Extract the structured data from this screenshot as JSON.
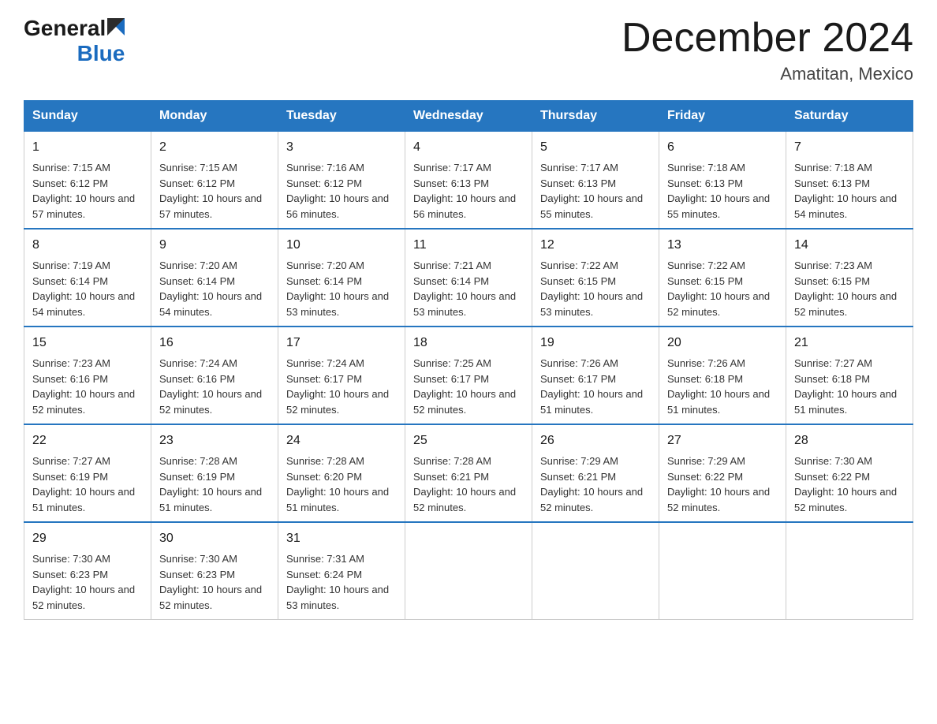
{
  "header": {
    "logo_general": "General",
    "logo_blue": "Blue",
    "month_title": "December 2024",
    "location": "Amatitan, Mexico"
  },
  "weekdays": [
    "Sunday",
    "Monday",
    "Tuesday",
    "Wednesday",
    "Thursday",
    "Friday",
    "Saturday"
  ],
  "weeks": [
    [
      {
        "day": "1",
        "sunrise": "7:15 AM",
        "sunset": "6:12 PM",
        "daylight": "10 hours and 57 minutes."
      },
      {
        "day": "2",
        "sunrise": "7:15 AM",
        "sunset": "6:12 PM",
        "daylight": "10 hours and 57 minutes."
      },
      {
        "day": "3",
        "sunrise": "7:16 AM",
        "sunset": "6:12 PM",
        "daylight": "10 hours and 56 minutes."
      },
      {
        "day": "4",
        "sunrise": "7:17 AM",
        "sunset": "6:13 PM",
        "daylight": "10 hours and 56 minutes."
      },
      {
        "day": "5",
        "sunrise": "7:17 AM",
        "sunset": "6:13 PM",
        "daylight": "10 hours and 55 minutes."
      },
      {
        "day": "6",
        "sunrise": "7:18 AM",
        "sunset": "6:13 PM",
        "daylight": "10 hours and 55 minutes."
      },
      {
        "day": "7",
        "sunrise": "7:18 AM",
        "sunset": "6:13 PM",
        "daylight": "10 hours and 54 minutes."
      }
    ],
    [
      {
        "day": "8",
        "sunrise": "7:19 AM",
        "sunset": "6:14 PM",
        "daylight": "10 hours and 54 minutes."
      },
      {
        "day": "9",
        "sunrise": "7:20 AM",
        "sunset": "6:14 PM",
        "daylight": "10 hours and 54 minutes."
      },
      {
        "day": "10",
        "sunrise": "7:20 AM",
        "sunset": "6:14 PM",
        "daylight": "10 hours and 53 minutes."
      },
      {
        "day": "11",
        "sunrise": "7:21 AM",
        "sunset": "6:14 PM",
        "daylight": "10 hours and 53 minutes."
      },
      {
        "day": "12",
        "sunrise": "7:22 AM",
        "sunset": "6:15 PM",
        "daylight": "10 hours and 53 minutes."
      },
      {
        "day": "13",
        "sunrise": "7:22 AM",
        "sunset": "6:15 PM",
        "daylight": "10 hours and 52 minutes."
      },
      {
        "day": "14",
        "sunrise": "7:23 AM",
        "sunset": "6:15 PM",
        "daylight": "10 hours and 52 minutes."
      }
    ],
    [
      {
        "day": "15",
        "sunrise": "7:23 AM",
        "sunset": "6:16 PM",
        "daylight": "10 hours and 52 minutes."
      },
      {
        "day": "16",
        "sunrise": "7:24 AM",
        "sunset": "6:16 PM",
        "daylight": "10 hours and 52 minutes."
      },
      {
        "day": "17",
        "sunrise": "7:24 AM",
        "sunset": "6:17 PM",
        "daylight": "10 hours and 52 minutes."
      },
      {
        "day": "18",
        "sunrise": "7:25 AM",
        "sunset": "6:17 PM",
        "daylight": "10 hours and 52 minutes."
      },
      {
        "day": "19",
        "sunrise": "7:26 AM",
        "sunset": "6:17 PM",
        "daylight": "10 hours and 51 minutes."
      },
      {
        "day": "20",
        "sunrise": "7:26 AM",
        "sunset": "6:18 PM",
        "daylight": "10 hours and 51 minutes."
      },
      {
        "day": "21",
        "sunrise": "7:27 AM",
        "sunset": "6:18 PM",
        "daylight": "10 hours and 51 minutes."
      }
    ],
    [
      {
        "day": "22",
        "sunrise": "7:27 AM",
        "sunset": "6:19 PM",
        "daylight": "10 hours and 51 minutes."
      },
      {
        "day": "23",
        "sunrise": "7:28 AM",
        "sunset": "6:19 PM",
        "daylight": "10 hours and 51 minutes."
      },
      {
        "day": "24",
        "sunrise": "7:28 AM",
        "sunset": "6:20 PM",
        "daylight": "10 hours and 51 minutes."
      },
      {
        "day": "25",
        "sunrise": "7:28 AM",
        "sunset": "6:21 PM",
        "daylight": "10 hours and 52 minutes."
      },
      {
        "day": "26",
        "sunrise": "7:29 AM",
        "sunset": "6:21 PM",
        "daylight": "10 hours and 52 minutes."
      },
      {
        "day": "27",
        "sunrise": "7:29 AM",
        "sunset": "6:22 PM",
        "daylight": "10 hours and 52 minutes."
      },
      {
        "day": "28",
        "sunrise": "7:30 AM",
        "sunset": "6:22 PM",
        "daylight": "10 hours and 52 minutes."
      }
    ],
    [
      {
        "day": "29",
        "sunrise": "7:30 AM",
        "sunset": "6:23 PM",
        "daylight": "10 hours and 52 minutes."
      },
      {
        "day": "30",
        "sunrise": "7:30 AM",
        "sunset": "6:23 PM",
        "daylight": "10 hours and 52 minutes."
      },
      {
        "day": "31",
        "sunrise": "7:31 AM",
        "sunset": "6:24 PM",
        "daylight": "10 hours and 53 minutes."
      },
      null,
      null,
      null,
      null
    ]
  ],
  "labels": {
    "sunrise": "Sunrise:",
    "sunset": "Sunset:",
    "daylight": "Daylight:"
  }
}
